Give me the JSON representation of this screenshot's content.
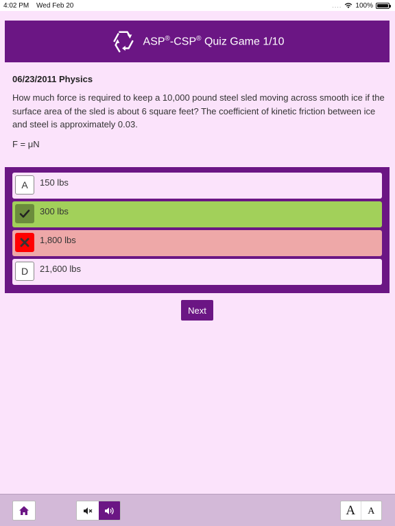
{
  "status_bar": {
    "time": "4:02 PM",
    "date": "Wed Feb 20",
    "dots": "....",
    "battery": "100%"
  },
  "header": {
    "title_part1": "ASP",
    "reg1": "®",
    "title_part2": "-CSP",
    "reg2": "®",
    "title_part3": " Quiz Game 1/10",
    "logo_icon": "hexagon-arrows-icon"
  },
  "question": {
    "heading": "06/23/2011 Physics",
    "text": "How much force is required to keep a 10,000 pound steel sled moving across smooth ice if the surface area of the sled is about 6 square feet? The coefficient of kinetic friction between ice and steel is approximately 0.03.",
    "formula": "F = μN"
  },
  "answers": [
    {
      "letter": "A",
      "label": "150 lbs",
      "state": "default"
    },
    {
      "letter": "",
      "label": "300 lbs",
      "state": "correct",
      "icon": "checkmark-icon"
    },
    {
      "letter": "",
      "label": "1,800 lbs",
      "state": "wrong",
      "icon": "x-mark-icon"
    },
    {
      "letter": "D",
      "label": "21,600 lbs",
      "state": "default"
    }
  ],
  "next_label": "Next",
  "footer": {
    "font_large": "A",
    "font_small": "A"
  },
  "colors": {
    "brand": "#6b1684",
    "background": "#fbe3fb",
    "correct": "#a2d05a",
    "wrong": "#eea8a8",
    "wrong_badge": "#ff0000"
  }
}
